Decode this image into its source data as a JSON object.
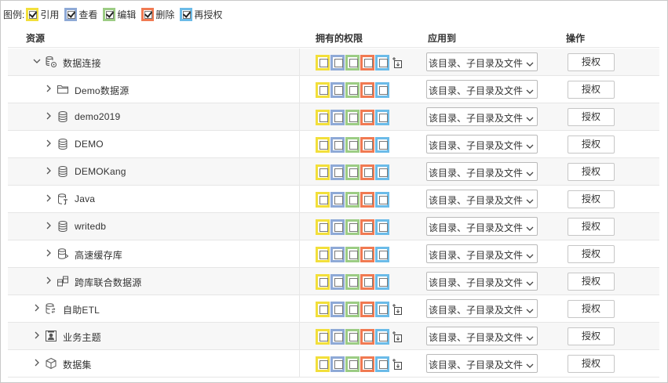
{
  "legend": {
    "label": "图例:",
    "items": [
      {
        "label": "引用",
        "color": "#f2df3b"
      },
      {
        "label": "查看",
        "color": "#8ea9d6"
      },
      {
        "label": "编辑",
        "color": "#9ccc84"
      },
      {
        "label": "删除",
        "color": "#f07a52"
      },
      {
        "label": "再授权",
        "color": "#6bbbe8"
      }
    ]
  },
  "columns": {
    "resource": "资源",
    "permissions": "拥有的权限",
    "apply_to": "应用到",
    "actions": "操作"
  },
  "apply_default": "该目录、子目录及文件",
  "action_label": "授权",
  "rows": [
    {
      "name": "数据连接",
      "icon": "database-group-icon",
      "level": 0,
      "expanded": true,
      "inherit": true
    },
    {
      "name": "Demo数据源",
      "icon": "folder-icon",
      "level": 1,
      "expanded": false,
      "inherit": false
    },
    {
      "name": "demo2019",
      "icon": "database-icon",
      "level": 1,
      "expanded": false,
      "inherit": false
    },
    {
      "name": "DEMO",
      "icon": "database-icon",
      "level": 1,
      "expanded": false,
      "inherit": false
    },
    {
      "name": "DEMOKang",
      "icon": "database-icon",
      "level": 1,
      "expanded": false,
      "inherit": false
    },
    {
      "name": "Java",
      "icon": "java-source-icon",
      "level": 1,
      "expanded": false,
      "inherit": false
    },
    {
      "name": "writedb",
      "icon": "database-icon",
      "level": 1,
      "expanded": false,
      "inherit": false
    },
    {
      "name": "高速缓存库",
      "icon": "cache-database-icon",
      "level": 1,
      "expanded": false,
      "inherit": false
    },
    {
      "name": "跨库联合数据源",
      "icon": "federated-database-icon",
      "level": 1,
      "expanded": false,
      "inherit": false
    },
    {
      "name": "自助ETL",
      "icon": "etl-icon",
      "level": 0,
      "expanded": false,
      "inherit": true
    },
    {
      "name": "业务主题",
      "icon": "business-theme-icon",
      "level": 0,
      "expanded": false,
      "inherit": true
    },
    {
      "name": "数据集",
      "icon": "dataset-cube-icon",
      "level": 0,
      "expanded": false,
      "inherit": true
    }
  ]
}
